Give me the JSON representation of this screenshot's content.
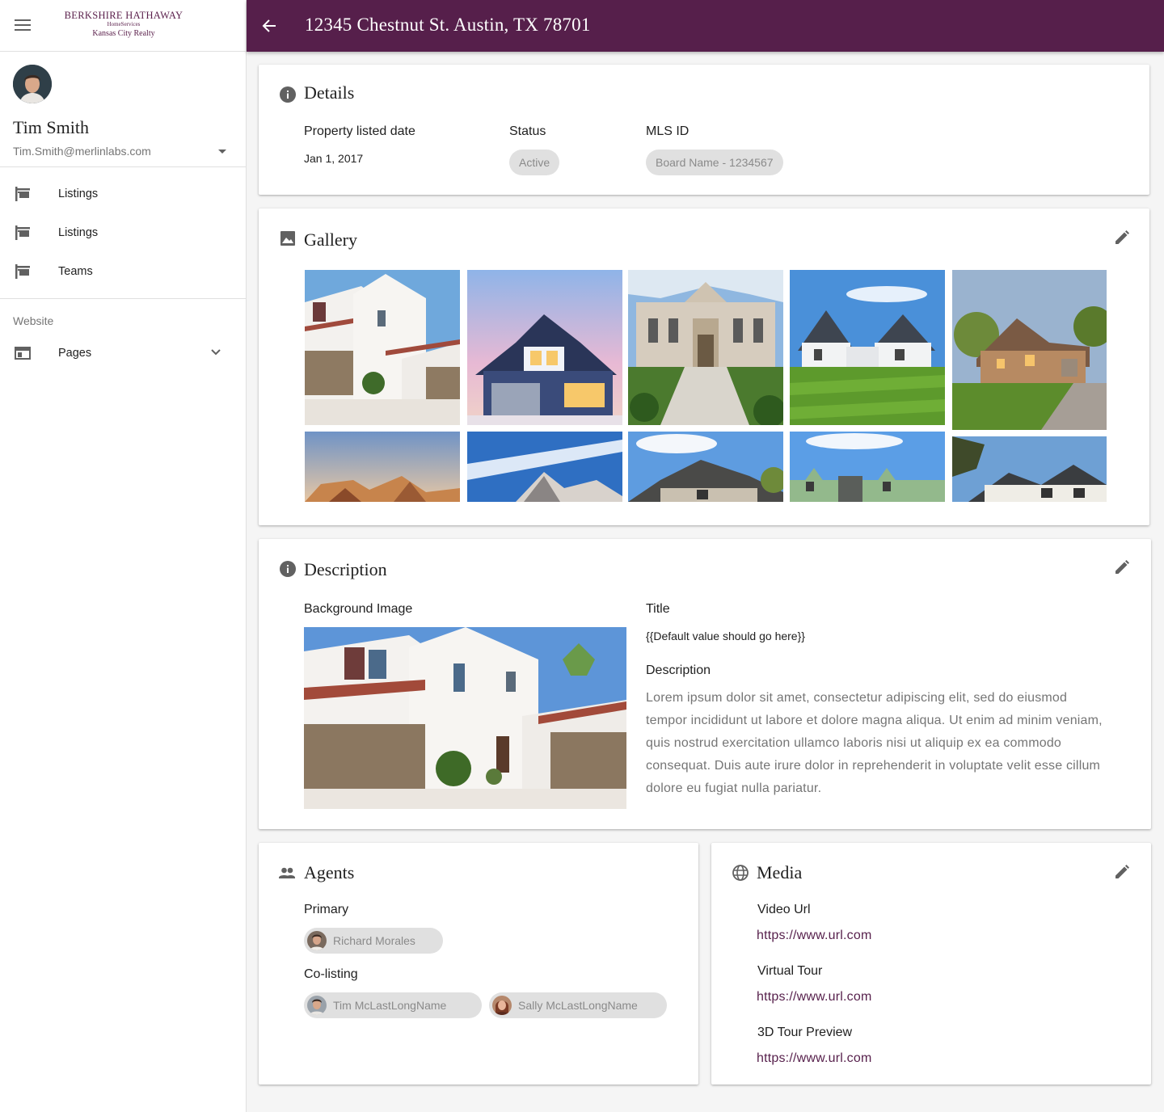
{
  "brand": {
    "line1": "BERKSHIRE HATHAWAY",
    "line2": "HomeServices",
    "line3": "Kansas City Realty",
    "color": "#561f4b"
  },
  "user": {
    "name": "Tim Smith",
    "email": "Tim.Smith@merlinlabs.com"
  },
  "nav": {
    "items": [
      {
        "label": "Listings",
        "icon": "signpost-icon"
      },
      {
        "label": "Listings",
        "icon": "signpost-icon"
      },
      {
        "label": "Teams",
        "icon": "signpost-icon"
      }
    ],
    "website_section": "Website",
    "pages_label": "Pages"
  },
  "header": {
    "title": "12345 Chestnut St. Austin, TX 78701"
  },
  "details": {
    "title": "Details",
    "listed_date_label": "Property listed date",
    "listed_date_value": "Jan 1, 2017",
    "status_label": "Status",
    "status_value": "Active",
    "mls_label": "MLS ID",
    "mls_value": "Board Name - 1234567"
  },
  "gallery": {
    "title": "Gallery",
    "photo_count": 10
  },
  "description": {
    "title": "Description",
    "bg_image_label": "Background Image",
    "title_label": "Title",
    "title_value": "{{Default value should go here}}",
    "desc_label": "Description",
    "desc_value": "Lorem ipsum dolor sit amet, consectetur adipiscing elit, sed do eiusmod tempor incididunt ut labore et dolore magna aliqua. Ut enim ad minim veniam, quis nostrud exercitation ullamco laboris nisi ut aliquip ex ea commodo consequat. Duis aute irure dolor in reprehenderit in voluptate velit esse cillum dolore eu fugiat nulla pariatur."
  },
  "agents": {
    "title": "Agents",
    "primary_label": "Primary",
    "primary": "Richard Morales",
    "colisting_label": "Co-listing",
    "colisting": [
      "Tim McLastLongName",
      "Sally McLastLongName"
    ]
  },
  "media": {
    "title": "Media",
    "video_label": "Video Url",
    "video_url": "https://www.url.com",
    "tour_label": "Virtual Tour",
    "tour_url": "https://www.url.com",
    "preview_label": "3D Tour Preview",
    "preview_url": "https://www.url.com"
  }
}
